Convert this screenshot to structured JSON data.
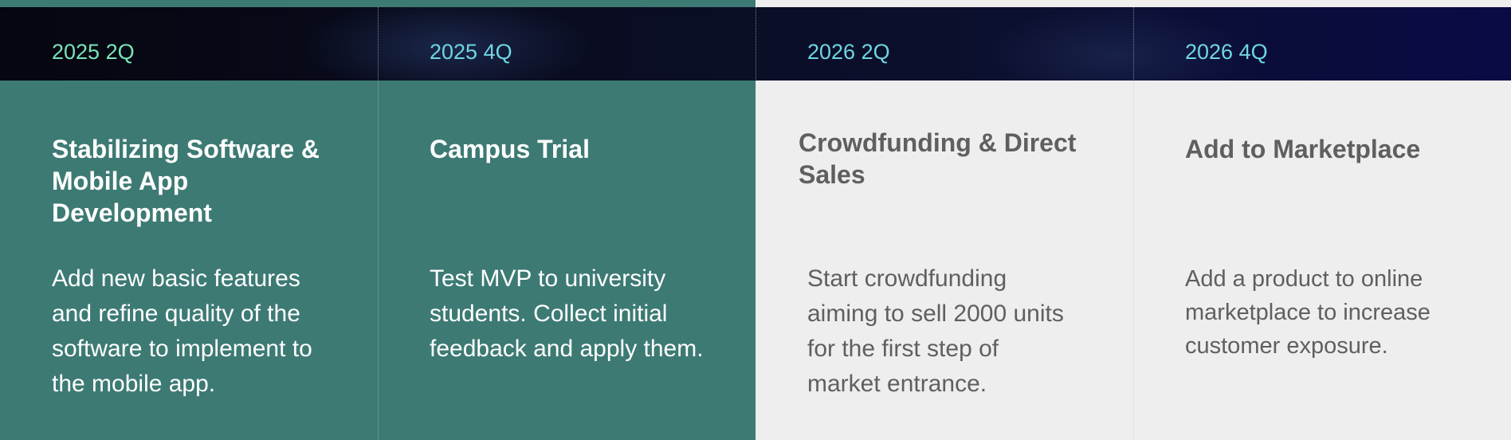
{
  "timeline": {
    "quarters": [
      "2025 2Q",
      "2025 4Q",
      "2026 2Q",
      "2026 4Q"
    ],
    "milestones": [
      {
        "title": "Stabilizing Software & Mobile App Development",
        "description": "Add new basic features and refine quality of the software to implement to the mobile app."
      },
      {
        "title": "Campus Trial",
        "description": "Test MVP to university students. Collect initial feedback and apply them."
      },
      {
        "title": "Crowdfunding & Direct Sales",
        "description": "Start crowdfunding aiming to sell 2000 units for the first step of market entrance."
      },
      {
        "title": "Add to Marketplace",
        "description": "Add a product to online marketplace to increase customer exposure."
      }
    ]
  },
  "colors": {
    "teal": "#3d7a74",
    "light_gray": "#eeeeee",
    "cyan_text": "#6fd6e0",
    "green_text": "#79e5b8"
  }
}
